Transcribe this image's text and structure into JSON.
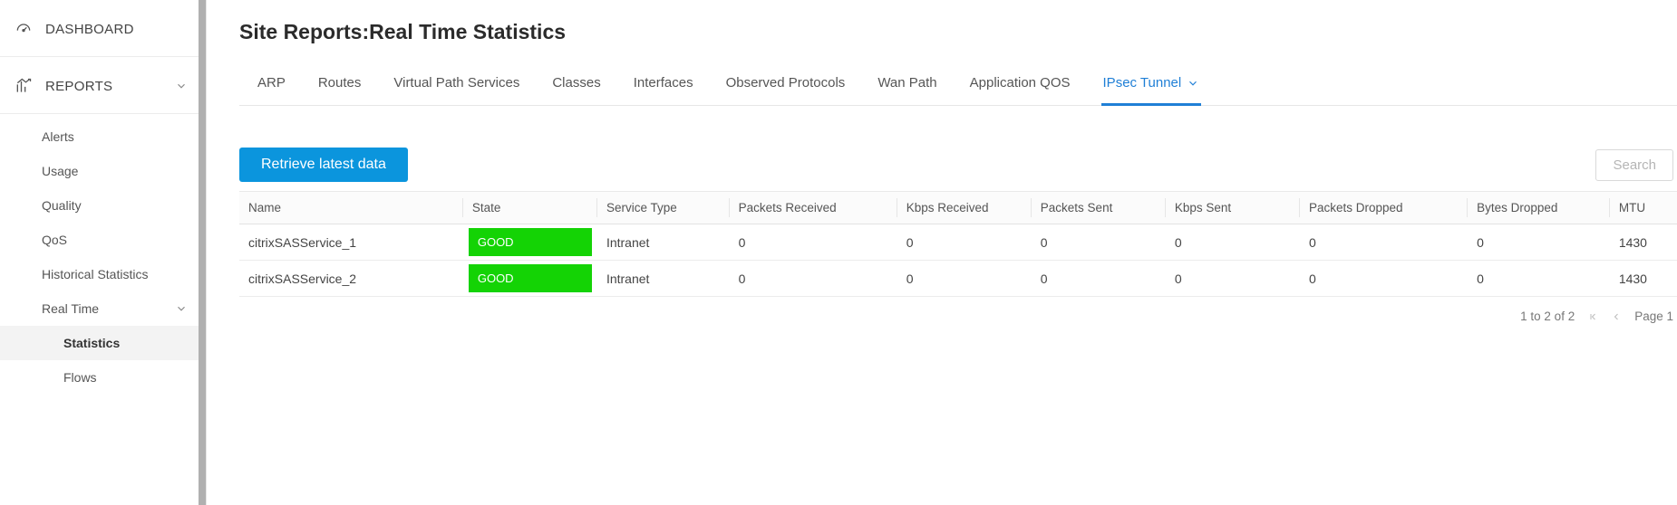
{
  "sidebar": {
    "dashboard": "DASHBOARD",
    "reports": "REPORTS",
    "items": [
      {
        "label": "Alerts"
      },
      {
        "label": "Usage"
      },
      {
        "label": "Quality"
      },
      {
        "label": "QoS"
      },
      {
        "label": "Historical Statistics"
      },
      {
        "label": "Real Time",
        "expanded": true,
        "children": [
          {
            "label": "Statistics",
            "active": true
          },
          {
            "label": "Flows"
          }
        ]
      }
    ]
  },
  "page": {
    "title": "Site Reports:Real Time Statistics"
  },
  "tabs": [
    {
      "label": "ARP"
    },
    {
      "label": "Routes"
    },
    {
      "label": "Virtual Path Services"
    },
    {
      "label": "Classes"
    },
    {
      "label": "Interfaces"
    },
    {
      "label": "Observed Protocols"
    },
    {
      "label": "Wan Path"
    },
    {
      "label": "Application QOS"
    },
    {
      "label": "IPsec Tunnel",
      "active": true,
      "dropdown": true
    }
  ],
  "toolbar": {
    "retrieve": "Retrieve latest data",
    "search": "Search"
  },
  "table": {
    "headers": [
      "Name",
      "State",
      "Service Type",
      "Packets Received",
      "Kbps Received",
      "Packets Sent",
      "Kbps Sent",
      "Packets Dropped",
      "Bytes Dropped",
      "MTU"
    ],
    "rows": [
      {
        "name": "citrixSASService_1",
        "state": "GOOD",
        "svc": "Intranet",
        "pr": "0",
        "kr": "0",
        "ps": "0",
        "ks": "0",
        "pd": "0",
        "bd": "0",
        "mtu": "1430"
      },
      {
        "name": "citrixSASService_2",
        "state": "GOOD",
        "svc": "Intranet",
        "pr": "0",
        "kr": "0",
        "ps": "0",
        "ks": "0",
        "pd": "0",
        "bd": "0",
        "mtu": "1430"
      }
    ]
  },
  "pager": {
    "range": "1 to 2 of 2",
    "page_label": "Page 1"
  }
}
